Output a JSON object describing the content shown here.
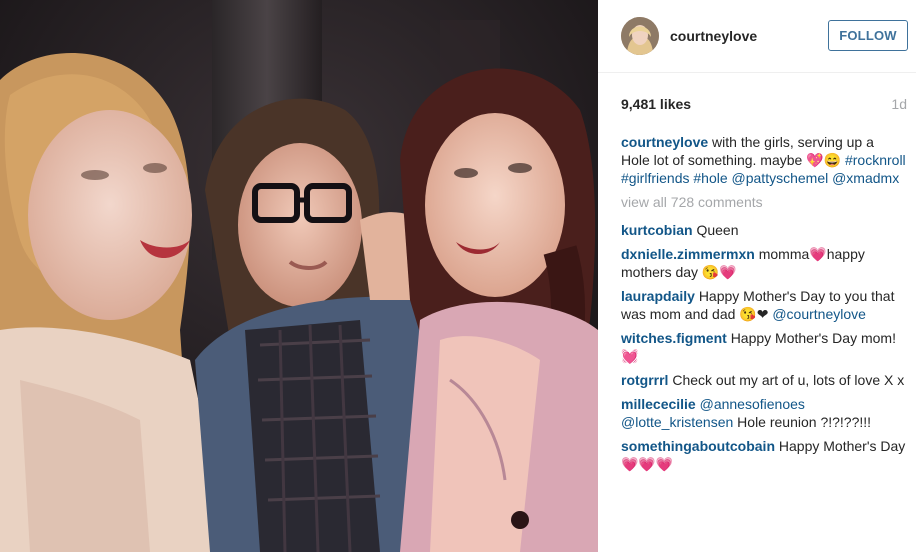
{
  "post": {
    "photo_alt": "",
    "colors": {
      "link": "#125688",
      "follow": "#3f729b",
      "muted": "#a5a7aa"
    }
  },
  "header": {
    "username": "courtneylove",
    "follow_label": "FOLLOW"
  },
  "stats": {
    "likes": "9,481 likes",
    "age": "1d"
  },
  "caption": {
    "user": "courtneylove",
    "text": "with the girls, serving up a Hole lot of something. maybe 💖😄",
    "hashtags": "#rocknroll #girlfriends #hole",
    "mentions": "@pattyschemel @xmadmx"
  },
  "view_all": "view all 728 comments",
  "comments": [
    {
      "user": "kurtcobian",
      "text": "Queen",
      "mention": ""
    },
    {
      "user": "dxnielle.zimmermxn",
      "text": "momma💗happy mothers day 😘💗",
      "mention": ""
    },
    {
      "user": "laurapdaily",
      "text": "Happy Mother's Day to you that was mom and dad 😘❤",
      "mention": "@courtneylove"
    },
    {
      "user": "witches.figment",
      "text": "Happy Mother's Day mom!💓",
      "mention": ""
    },
    {
      "user": "rotgrrrl",
      "text": "Check out my art of u, lots of love X x",
      "mention": ""
    },
    {
      "user": "millececilie",
      "text": "Hole reunion ?!?!??!!!",
      "mention": "@annesofienoes @lotte_kristensen"
    },
    {
      "user": "somethingaboutcobain",
      "text": "Happy Mother's Day 💗💗💗",
      "mention": ""
    }
  ]
}
